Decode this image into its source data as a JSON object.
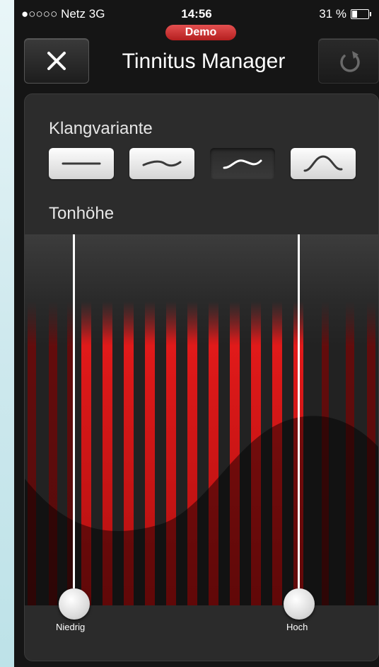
{
  "status_bar": {
    "carrier": "●○○○○ Netz  3G",
    "time": "14:56",
    "battery": "31 %"
  },
  "badge": "Demo",
  "nav": {
    "title": "Tinnitus Manager",
    "close_icon": "close-icon",
    "refresh_icon": "refresh-icon"
  },
  "sections": {
    "sound_variant_label": "Klangvariante",
    "pitch_label": "Tonhöhe"
  },
  "sound_variants": [
    {
      "icon": "flat-line-icon",
      "selected": false
    },
    {
      "icon": "gentle-wave-icon",
      "selected": false
    },
    {
      "icon": "medium-wave-icon",
      "selected": true
    },
    {
      "icon": "strong-wave-icon",
      "selected": false
    }
  ],
  "pitch_slider": {
    "low_label": "Niedrig",
    "high_label": "Hoch"
  },
  "colors": {
    "accent_red": "#d81818",
    "badge_red": "#c83030",
    "background": "#151515"
  }
}
